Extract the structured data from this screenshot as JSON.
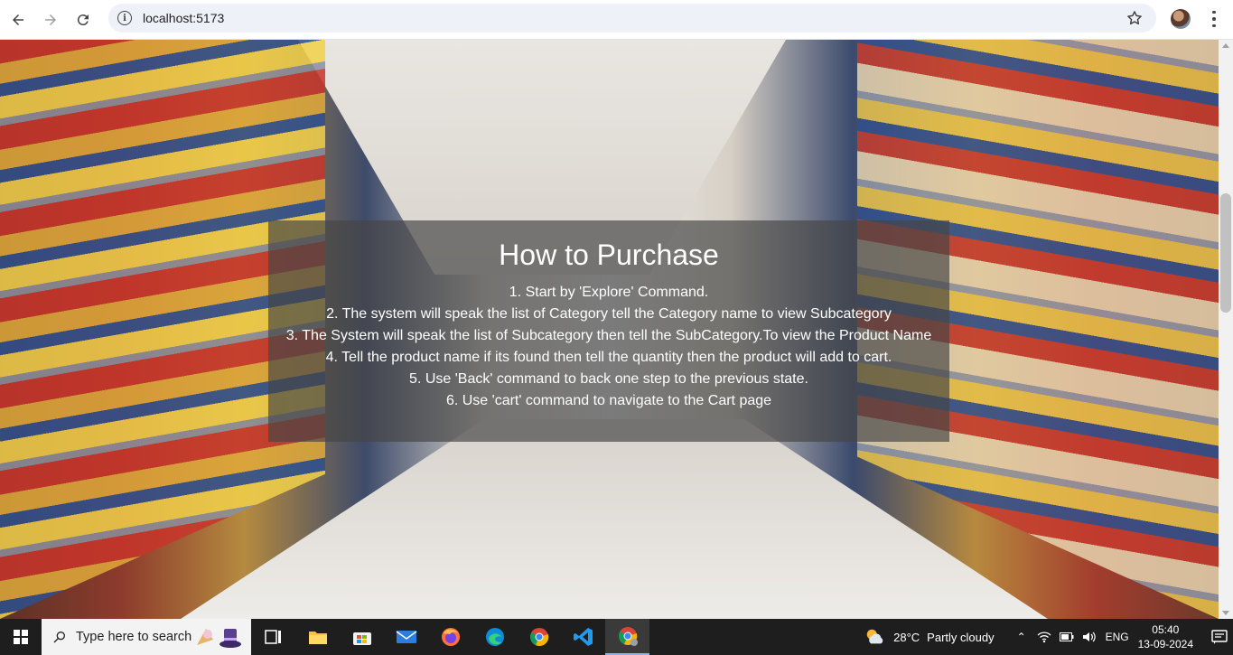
{
  "browser": {
    "url": "localhost:5173"
  },
  "page": {
    "heading": "How to Purchase",
    "steps": [
      "1. Start by 'Explore' Command.",
      "2. The system will speak the list of Category tell the Category name to view Subcategory",
      "3. The System will speak the list of Subcategory then tell the SubCategory.To view the Product Name",
      "4. Tell the product name if its found then tell the quantity then the product will add to cart.",
      "5. Use 'Back' command to back one step to the previous state.",
      "6. Use 'cart' command to navigate to the Cart page"
    ]
  },
  "taskbar": {
    "search_placeholder": "Type here to search",
    "apps": [
      "task-view-icon",
      "file-explorer-icon",
      "store-icon",
      "mail-icon",
      "firefox-icon",
      "edge-icon",
      "chrome-icon",
      "vscode-icon",
      "chrome-active-icon"
    ],
    "weather": {
      "temp": "28°C",
      "condition": "Partly cloudy"
    },
    "language": "ENG",
    "time": "05:40",
    "date": "13-09-2024"
  },
  "colors": {
    "overlay": "#464646",
    "taskbar": "#1e1e1e",
    "omnibox": "#eef1f8"
  }
}
